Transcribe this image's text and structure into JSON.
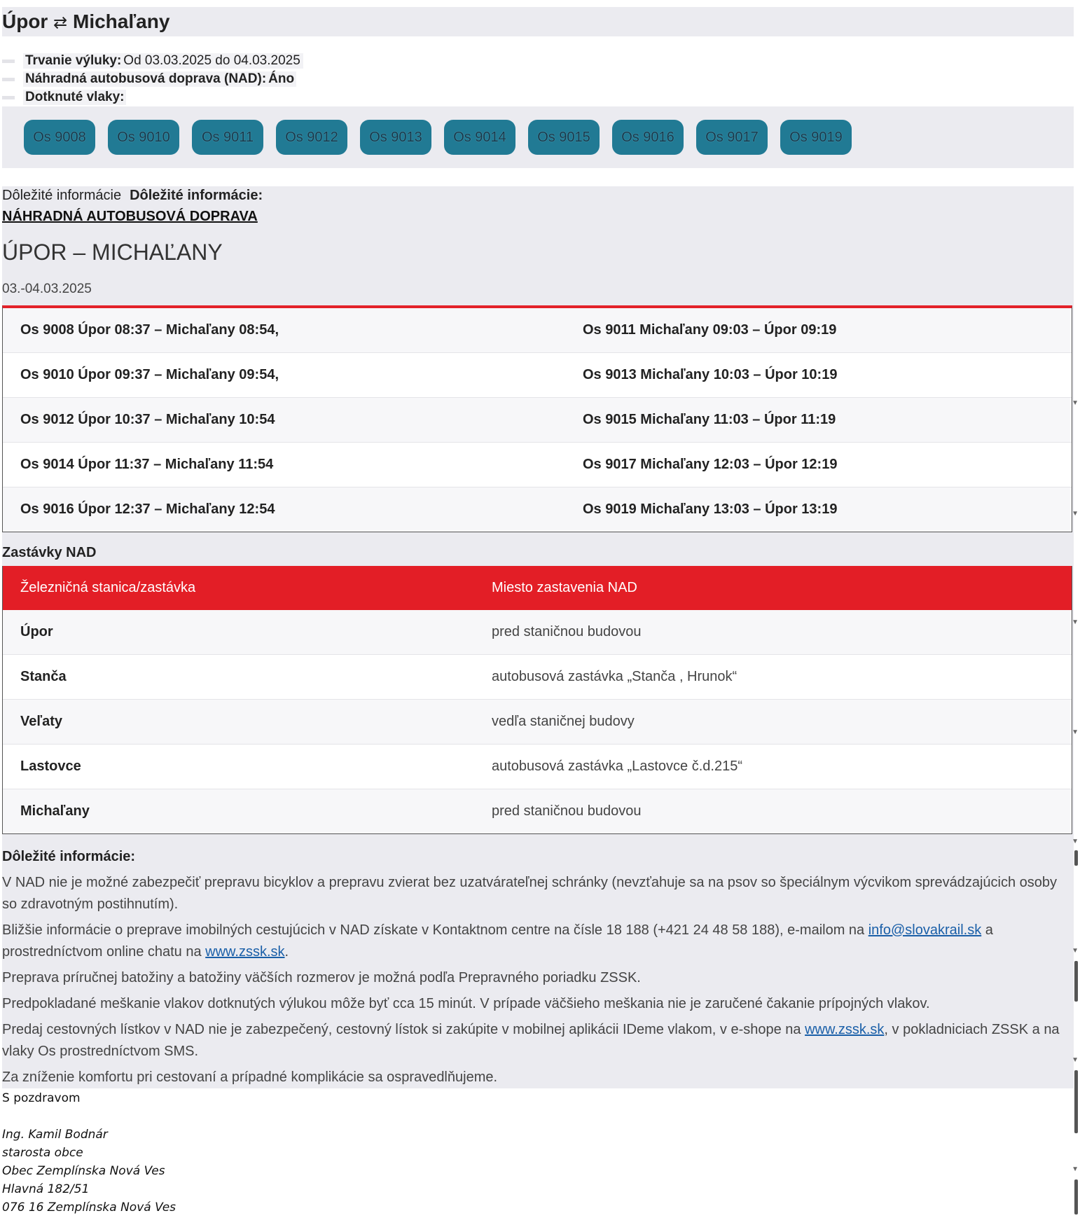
{
  "header": {
    "from": "Úpor",
    "swap_icon": "⇄",
    "to": "Michaľany"
  },
  "meta": {
    "duration_label": "Trvanie výluky:",
    "duration_value": "Od 03.03.2025 do 04.03.2025",
    "nad_label": "Náhradná autobusová doprava (NAD):",
    "nad_value": "Áno",
    "trains_label": "Dotknuté vlaky:"
  },
  "trains": [
    "Os 9008",
    "Os 9010",
    "Os 9011",
    "Os 9012",
    "Os 9013",
    "Os 9014",
    "Os 9015",
    "Os 9016",
    "Os 9017",
    "Os 9019"
  ],
  "info": {
    "heading_plain": "Dôležité informácie",
    "heading_bold": "Dôležité informácie:",
    "nad_title": "NÁHRADNÁ AUTOBUSOVÁ DOPRAVA",
    "route": "ÚPOR – MICHAĽANY",
    "dates": "03.-04.03.2025"
  },
  "schedule": [
    [
      "Os 9008  Úpor 08:37 – Michaľany 08:54,",
      "Os 9011 Michaľany 09:03 – Úpor 09:19"
    ],
    [
      "Os 9010  Úpor 09:37 – Michaľany 09:54,",
      "Os 9013 Michaľany 10:03 – Úpor 10:19"
    ],
    [
      "Os 9012  Úpor 10:37 – Michaľany 10:54",
      "Os 9015 Michaľany 11:03 – Úpor 11:19"
    ],
    [
      "Os 9014  Úpor 11:37 – Michaľany 11:54",
      "Os 9017 Michaľany 12:03 – Úpor 12:19"
    ],
    [
      "Os 9016  Úpor 12:37 – Michaľany 12:54",
      "Os 9019 Michaľany 13:03 – Úpor 13:19"
    ]
  ],
  "stops": {
    "title": "Zastávky NAD",
    "col1": "Železničná stanica/zastávka",
    "col2": "Miesto zastavenia NAD",
    "rows": [
      [
        "Úpor",
        "pred staničnou budovou"
      ],
      [
        "Stanča",
        "autobusová zastávka „Stanča , Hrunok“"
      ],
      [
        "Veľaty",
        "vedľa staničnej budovy"
      ],
      [
        "Lastovce",
        "autobusová zastávka „Lastovce č.d.215“"
      ],
      [
        "Michaľany",
        "pred staničnou budovou"
      ]
    ]
  },
  "notes": {
    "heading": "Dôležité informácie:",
    "p1": "V NAD nie je možné zabezpečiť prepravu bicyklov a prepravu zvierat bez uzatvárateľnej schránky (nevzťahuje sa na psov so špeciálnym výcvikom sprevádzajúcich osoby so zdravotným postihnutím).",
    "p2_a": "Bližšie informácie o preprave imobilných cestujúcich v NAD získate v Kontaktnom centre na čísle 18 188 (+421 24 48 58 188), e-mailom na ",
    "p2_link1": "info@slovakrail.sk",
    "p2_b": " a prostredníctvom online chatu na ",
    "p2_link2": "www.zssk.sk",
    "p2_c": ".",
    "p3": "Preprava príručnej batožiny a batožiny väčších rozmerov je možná podľa Prepravného poriadku ZSSK.",
    "p4": "Predpokladané meškanie vlakov dotknutých výlukou môže byť cca 15 minút. V prípade väčšieho meškania nie je zaručené čakanie prípojných vlakov.",
    "p5_a": "Predaj cestovných lístkov v NAD nie je zabezpečený, cestovný lístok si zakúpite v mobilnej aplikácii IDeme vlakom, v e-shope na ",
    "p5_link": "www.zssk.sk",
    "p5_b": ", v pokladniciach ZSSK a na vlaky Os prostredníctvom SMS.",
    "p6": "Za zníženie komfortu pri cestovaní a prípadné komplikácie sa ospravedlňujeme."
  },
  "signoff": {
    "greeting": "S pozdravom",
    "name": "Ing. Kamil Bodnár",
    "role": "starosta obce",
    "org": "Obec Zemplínska Nová Ves",
    "street": "Hlavná 182/51",
    "city": "076 16 Zemplínska Nová Ves"
  },
  "colors": {
    "accent_red": "#e31e26",
    "train_button": "#217a94",
    "panel": "#ebebf0",
    "link": "#1a5fa8"
  }
}
